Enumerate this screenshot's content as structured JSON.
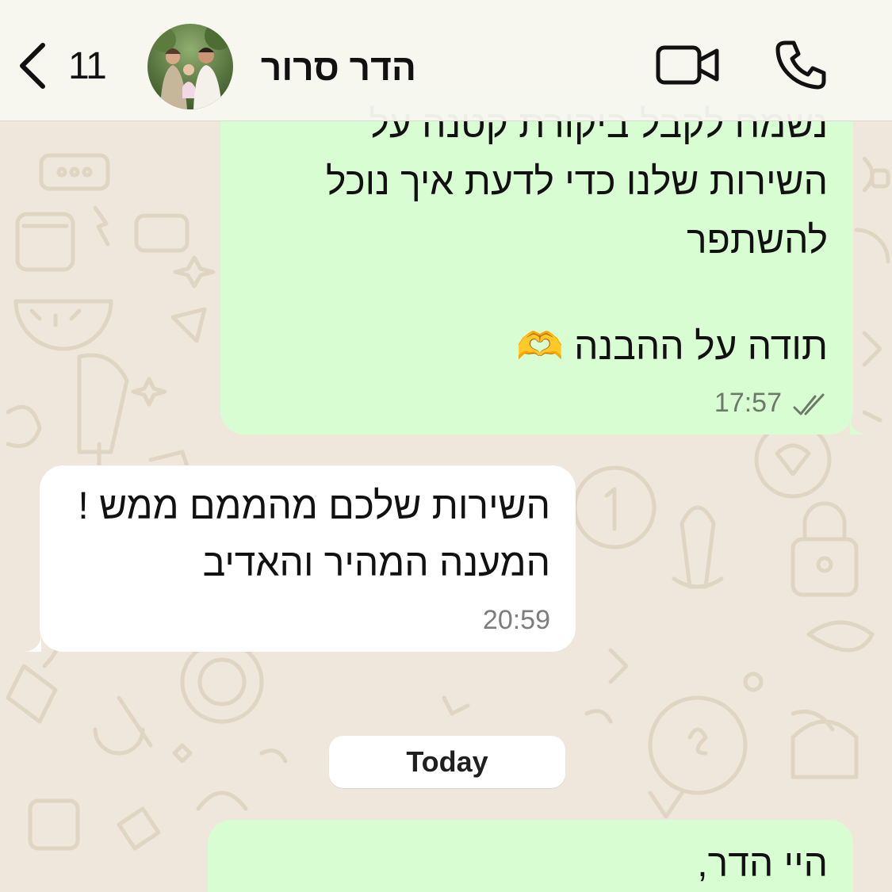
{
  "header": {
    "back_count": "11",
    "contact_name": "הדר סרור",
    "icons": {
      "back": "chevron-left-icon",
      "video": "video-camera-icon",
      "call": "phone-icon"
    }
  },
  "messages": [
    {
      "direction": "outgoing",
      "lines": [
        "נשמח לקבל ביקורת קטנה על",
        "השירות שלנו כדי לדעת איך נוכל",
        "להשתפר",
        "",
        "תודה על ההבנה 🫶"
      ],
      "time": "17:57",
      "status": "read"
    },
    {
      "direction": "incoming",
      "lines": [
        "השירות שלכם מהממם ממש !",
        "המענה המהיר והאדיב"
      ],
      "time": "20:59"
    }
  ],
  "date_separator": "Today",
  "last_message": {
    "direction": "outgoing",
    "lines": [
      "היי הדר,"
    ]
  },
  "colors": {
    "outgoing_bubble": "#d9fdd3",
    "incoming_bubble": "#ffffff",
    "wallpaper": "#efe7dc",
    "read_ticks": "#6c7a68"
  }
}
